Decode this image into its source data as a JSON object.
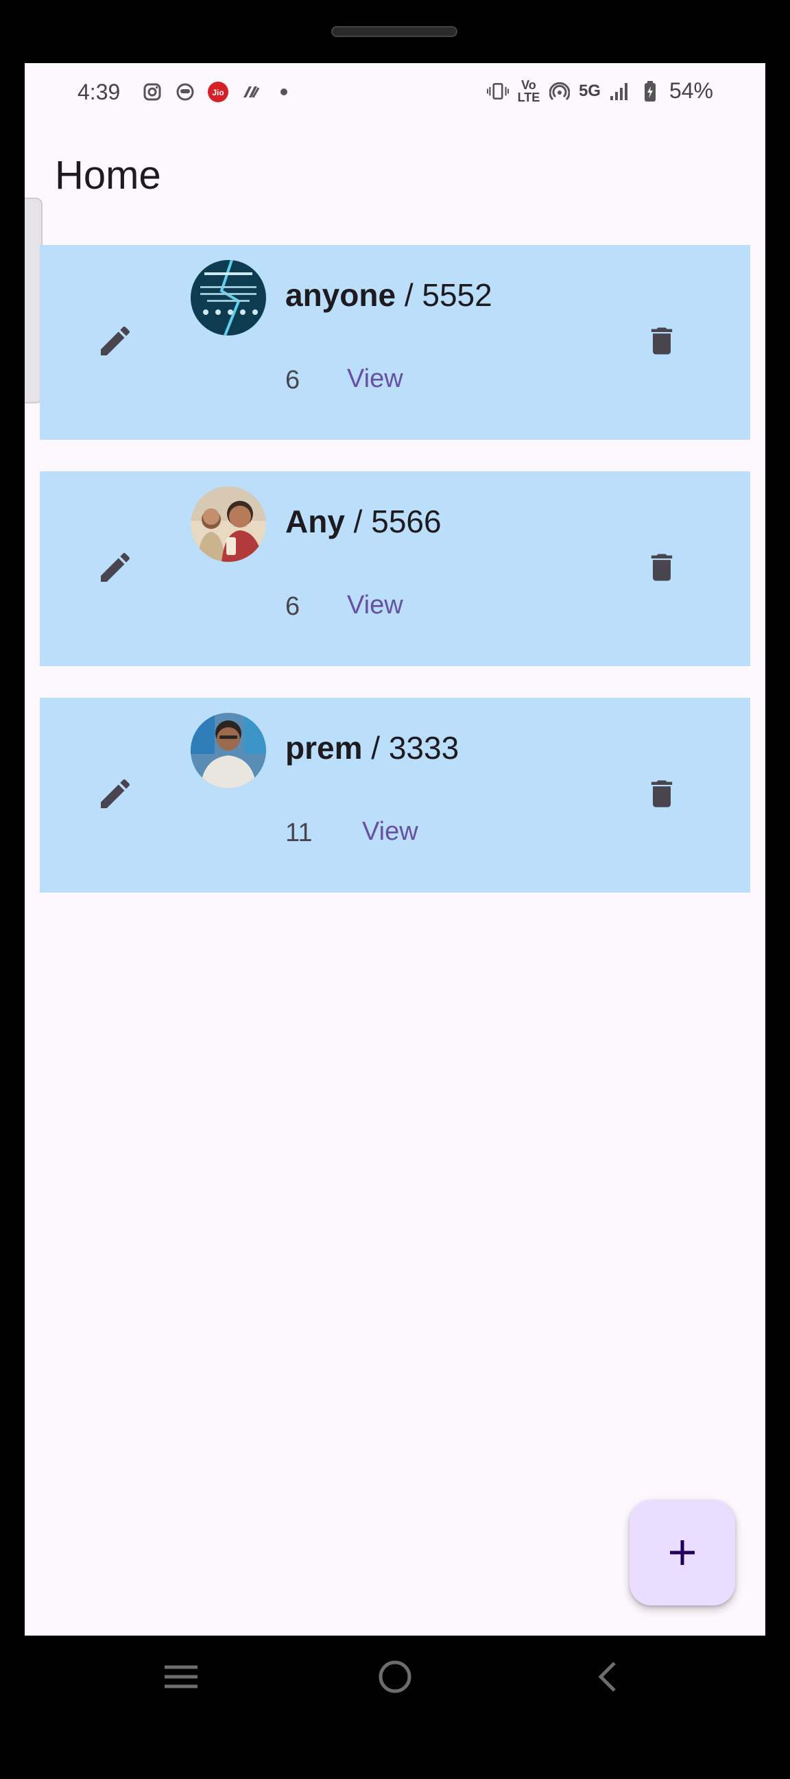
{
  "status_bar": {
    "time": "4:39",
    "left_icons": [
      "instagram-icon",
      "app-icon",
      "jio-icon",
      "app-icon-2",
      "dot-icon"
    ],
    "network_label": "5G",
    "lte_label": "Vo LTE",
    "battery": "54%"
  },
  "app_bar": {
    "title": "Home"
  },
  "cards": [
    {
      "name": "anyone",
      "separator": " / ",
      "code": "5552",
      "count": "6",
      "view_label": "View",
      "avatar_colors": [
        "#0d3b4f",
        "#1b6a85"
      ]
    },
    {
      "name": "Any",
      "separator": " / ",
      "code": "5566",
      "count": "6",
      "view_label": "View",
      "avatar_colors": [
        "#c99a6b",
        "#8a4a3a"
      ]
    },
    {
      "name": "prem",
      "separator": " / ",
      "code": "3333",
      "count": "11",
      "view_label": "View",
      "avatar_colors": [
        "#2f7db8",
        "#e9e5df"
      ]
    }
  ],
  "fab": {
    "icon": "plus-icon"
  },
  "nav": {
    "items": [
      "menu-icon",
      "home-icon",
      "back-icon"
    ]
  },
  "colors": {
    "card_bg": "#bbdefa",
    "screen_bg": "#fdf7fe",
    "accent": "#6750a4",
    "fab_bg": "#eaddff"
  }
}
